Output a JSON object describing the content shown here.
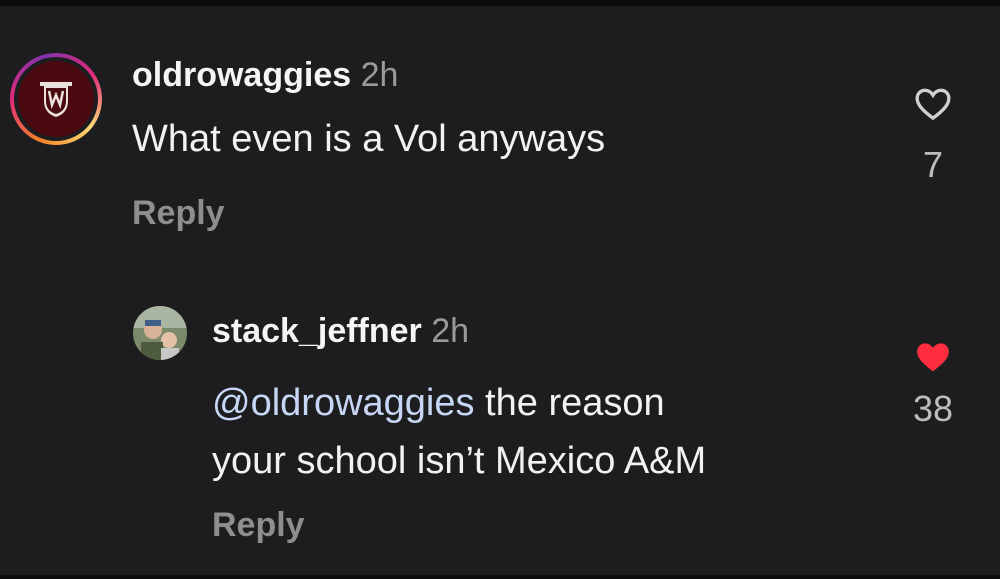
{
  "comments": [
    {
      "username": "oldrowaggies",
      "time": "2h",
      "text": "What even is a Vol anyways",
      "reply_label": "Reply",
      "likes": "7",
      "liked": false,
      "avatar": "maroon-crest-avatar"
    },
    {
      "username": "stack_jeffner",
      "time": "2h",
      "mention": "@oldrowaggies",
      "text_line1": " the reason",
      "text_line2": "your school isn’t Mexico A&M",
      "reply_label": "Reply",
      "likes": "38",
      "liked": true,
      "avatar": "photo-avatar"
    }
  ],
  "colors": {
    "background": "#1d1d1f",
    "liked_heart": "#ff2d3d",
    "time": "#9a9a9a",
    "mention": "#c7d6f5"
  }
}
